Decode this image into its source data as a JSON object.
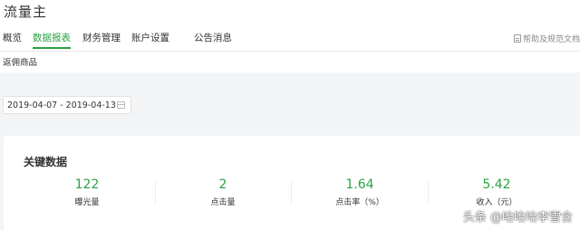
{
  "app": {
    "title": "流量主"
  },
  "nav": {
    "tabs": [
      {
        "label": "概览"
      },
      {
        "label": "数据报表"
      },
      {
        "label": "财务管理"
      },
      {
        "label": "账户设置"
      },
      {
        "label": "公告消息"
      }
    ],
    "help_label": "帮助及规范文档"
  },
  "subnav": {
    "item": "返佣商品"
  },
  "date_range": {
    "value": "2019-04-07 - 2019-04-13"
  },
  "key_data": {
    "title": "关键数据",
    "metrics": [
      {
        "value": "122",
        "label": "曝光量"
      },
      {
        "value": "2",
        "label": "点击量"
      },
      {
        "value": "1.64",
        "label": "点击率（%）"
      },
      {
        "value": "5.42",
        "label": "收入（元）"
      }
    ]
  },
  "watermark": {
    "text": "头条 @咍咍咍李雪含"
  },
  "colors": {
    "accent": "#2aa244",
    "background": "#f3f4f6"
  }
}
